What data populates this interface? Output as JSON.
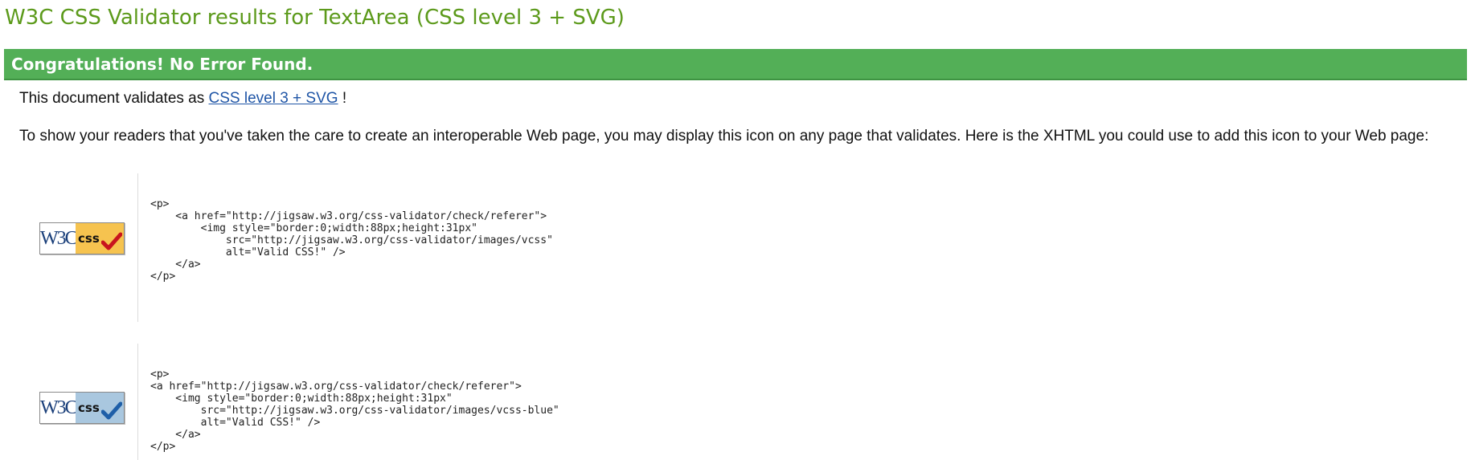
{
  "page": {
    "title": "W3C CSS Validator results for TextArea (CSS level 3 + SVG)"
  },
  "banner": {
    "text": "Congratulations! No Error Found."
  },
  "validates": {
    "prefix": "This document validates as ",
    "link_label": "CSS level 3 + SVG",
    "suffix": " !"
  },
  "readers_paragraph": "To show your readers that you've taken the care to create an interoperable Web page, you may display this icon on any page that validates. Here is the XHTML you could use to add this icon to your Web page:",
  "badges": [
    {
      "w3c_label": "W3C",
      "css_label": "css",
      "icon": "w3c-css-gold-badge-icon",
      "code": "<p>\n    <a href=\"http://jigsaw.w3.org/css-validator/check/referer\">\n        <img style=\"border:0;width:88px;height:31px\"\n            src=\"http://jigsaw.w3.org/css-validator/images/vcss\"\n            alt=\"Valid CSS!\" />\n    </a>\n</p>"
    },
    {
      "w3c_label": "W3C",
      "css_label": "css",
      "icon": "w3c-css-blue-badge-icon",
      "code": "<p>\n<a href=\"http://jigsaw.w3.org/css-validator/check/referer\">\n    <img style=\"border:0;width:88px;height:31px\"\n        src=\"http://jigsaw.w3.org/css-validator/images/vcss-blue\"\n        alt=\"Valid CSS!\" />\n    </a>\n</p>"
    }
  ],
  "colors": {
    "title": "#5c9a1b",
    "banner_background": "#53af57",
    "link": "#1f55a6",
    "gold_badge": "#f6c34f",
    "blue_badge": "#a9c7df",
    "gold_check": "#c8141e",
    "blue_check": "#1f5fa8"
  }
}
